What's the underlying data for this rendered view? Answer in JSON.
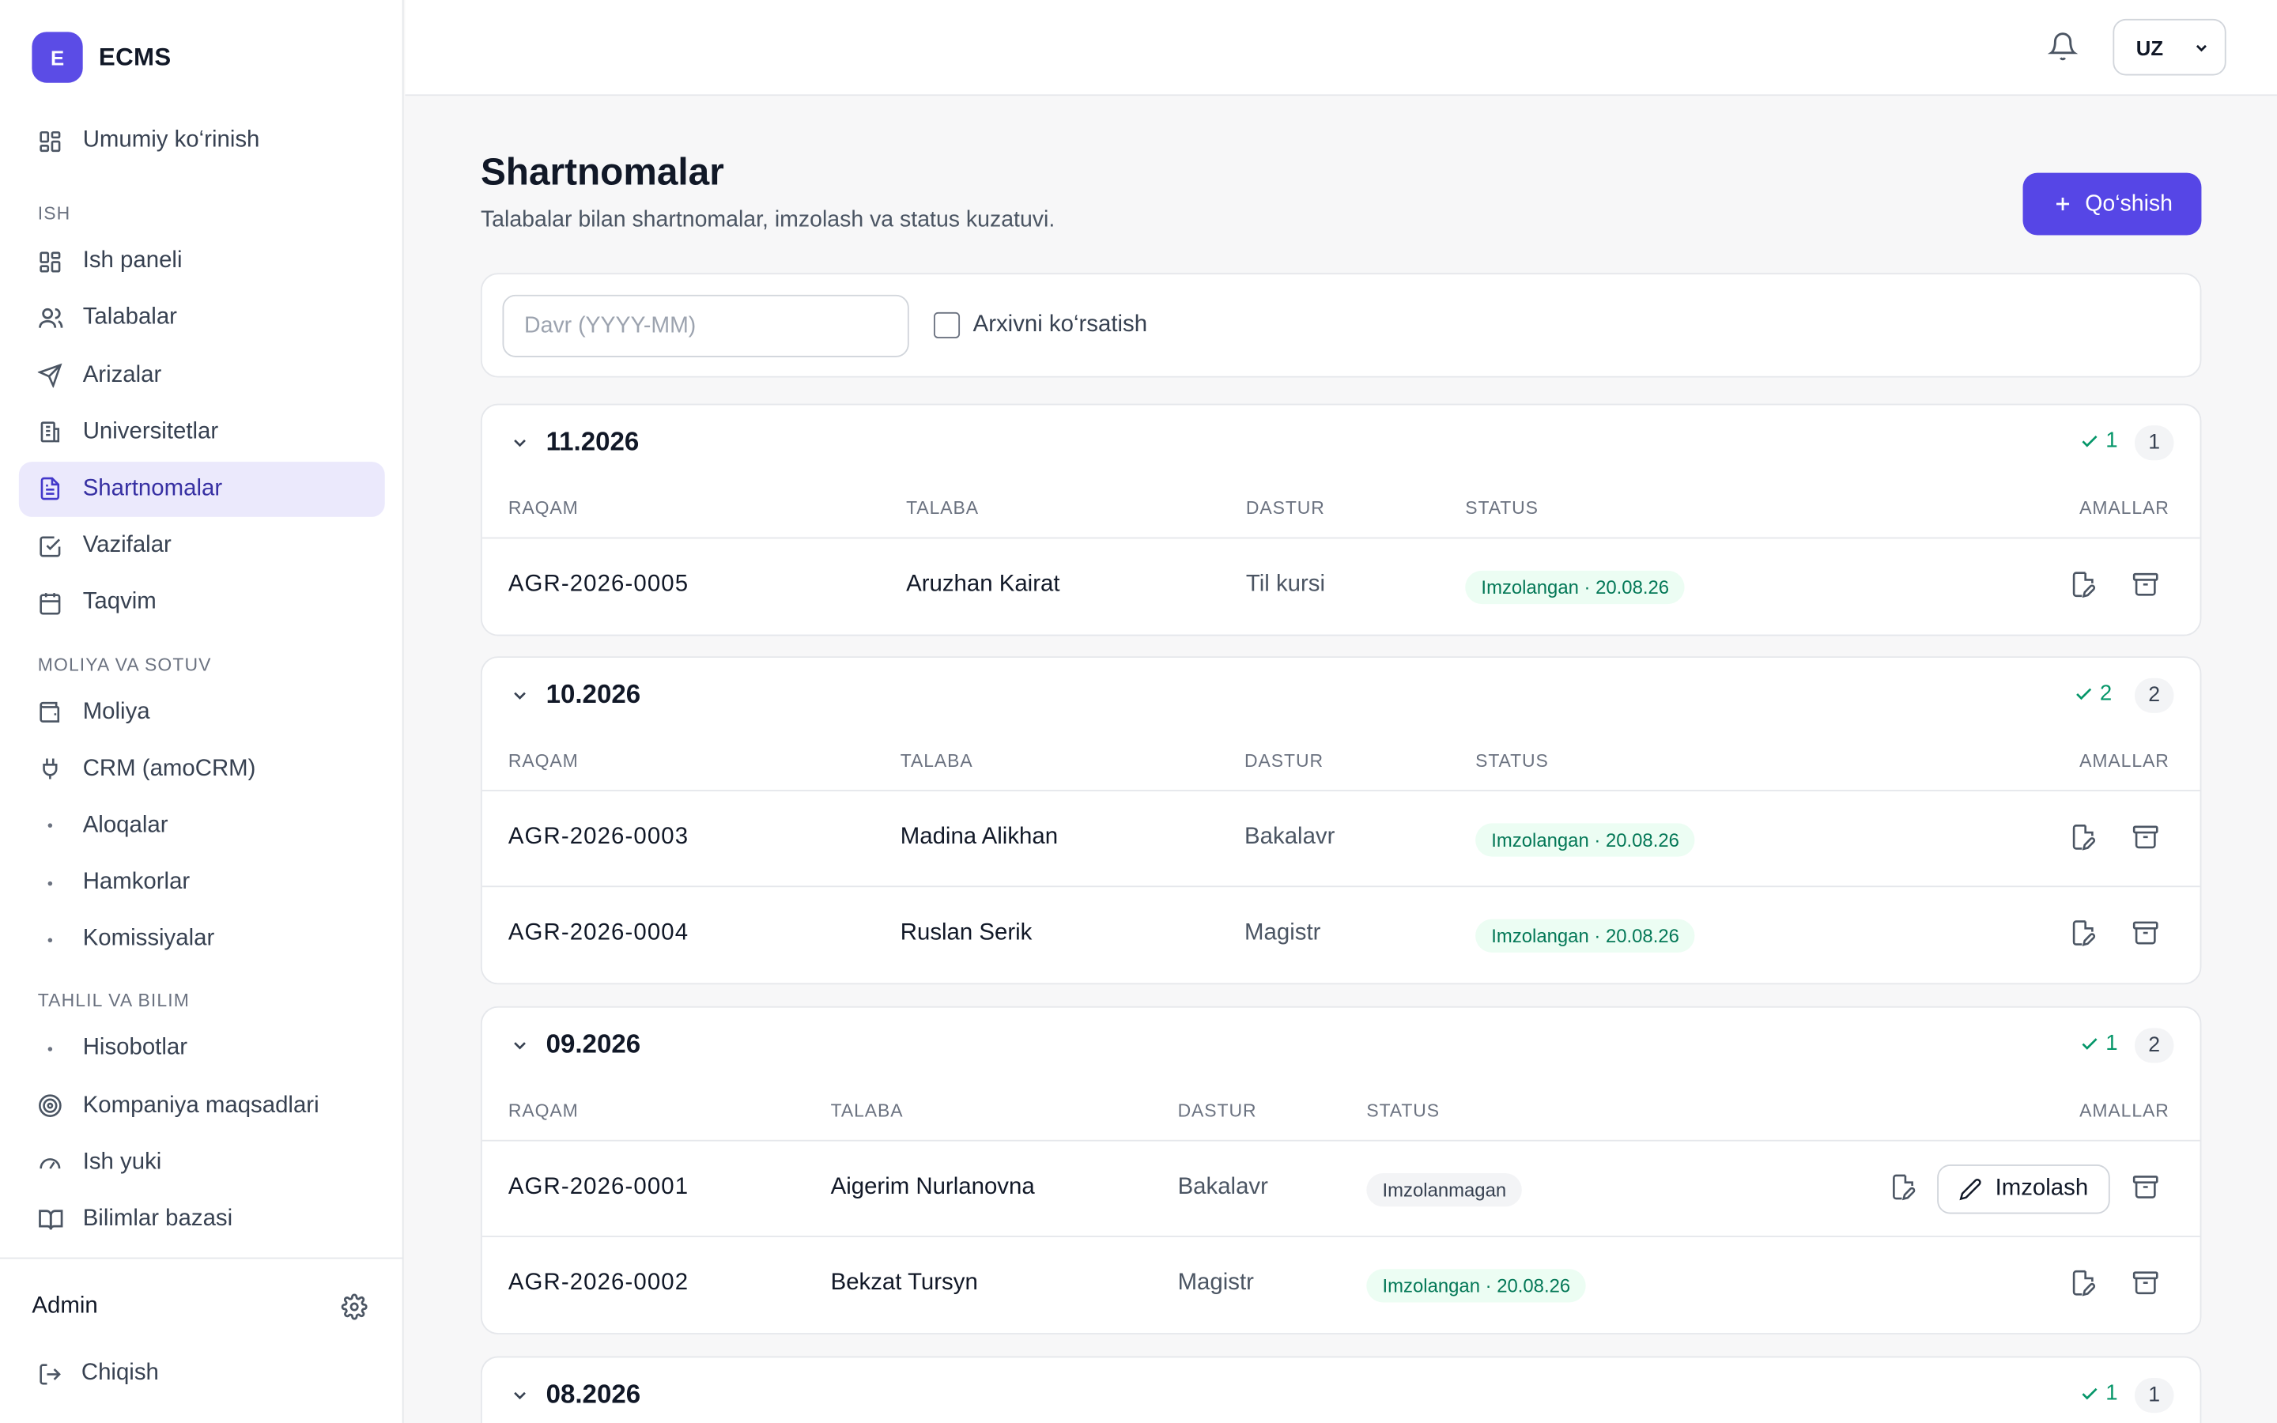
{
  "brand": {
    "logo_letter": "E",
    "name": "ECMS"
  },
  "sidebar": {
    "overview": "Umumiy ko‘rinish",
    "sections": [
      {
        "title": "ISH",
        "items": [
          "Ish paneli",
          "Talabalar",
          "Arizalar",
          "Universitetlar",
          "Shartnomalar",
          "Vazifalar",
          "Taqvim"
        ]
      },
      {
        "title": "MOLIYA VA SOTUV",
        "items": [
          "Moliya",
          "CRM (amoCRM)",
          "Aloqalar",
          "Hamkorlar",
          "Komissiyalar"
        ]
      },
      {
        "title": "TAHLIL VA BILIM",
        "items": [
          "Hisobotlar",
          "Kompaniya maqsadlari",
          "Ish yuki",
          "Bilimlar bazasi"
        ]
      }
    ],
    "active": "Shartnomalar",
    "user": "Admin",
    "logout": "Chiqish"
  },
  "topbar": {
    "language": "UZ"
  },
  "page": {
    "title": "Shartnomalar",
    "subtitle": "Talabalar bilan shartnomalar, imzolash va status kuzatuvi.",
    "add_button": "Qo‘shish"
  },
  "filters": {
    "period_placeholder": "Davr (YYYY-MM)",
    "archive_label": "Arxivni ko‘rsatish"
  },
  "columns": {
    "number": "RAQAM",
    "student": "TALABA",
    "program": "DASTUR",
    "status": "STATUS",
    "actions": "AMALLAR"
  },
  "groups": [
    {
      "period": "11.2026",
      "signed": "1",
      "total": "1",
      "rows": [
        {
          "number": "AGR-2026-0005",
          "student": "Aruzhan Kairat",
          "program": "Til kursi",
          "status": "Imzolangan · 20.08.26",
          "signed": true
        }
      ]
    },
    {
      "period": "10.2026",
      "signed": "2",
      "total": "2",
      "rows": [
        {
          "number": "AGR-2026-0003",
          "student": "Madina Alikhan",
          "program": "Bakalavr",
          "status": "Imzolangan · 20.08.26",
          "signed": true
        },
        {
          "number": "AGR-2026-0004",
          "student": "Ruslan Serik",
          "program": "Magistr",
          "status": "Imzolangan · 20.08.26",
          "signed": true
        }
      ]
    },
    {
      "period": "09.2026",
      "signed": "1",
      "total": "2",
      "rows": [
        {
          "number": "AGR-2026-0001",
          "student": "Aigerim Nurlanovna",
          "program": "Bakalavr",
          "status": "Imzolanmagan",
          "signed": false,
          "sign_label": "Imzolash"
        },
        {
          "number": "AGR-2026-0002",
          "student": "Bekzat Tursyn",
          "program": "Magistr",
          "status": "Imzolangan · 20.08.26",
          "signed": true
        }
      ]
    },
    {
      "period": "08.2026",
      "signed": "1",
      "total": "1",
      "rows": []
    }
  ]
}
